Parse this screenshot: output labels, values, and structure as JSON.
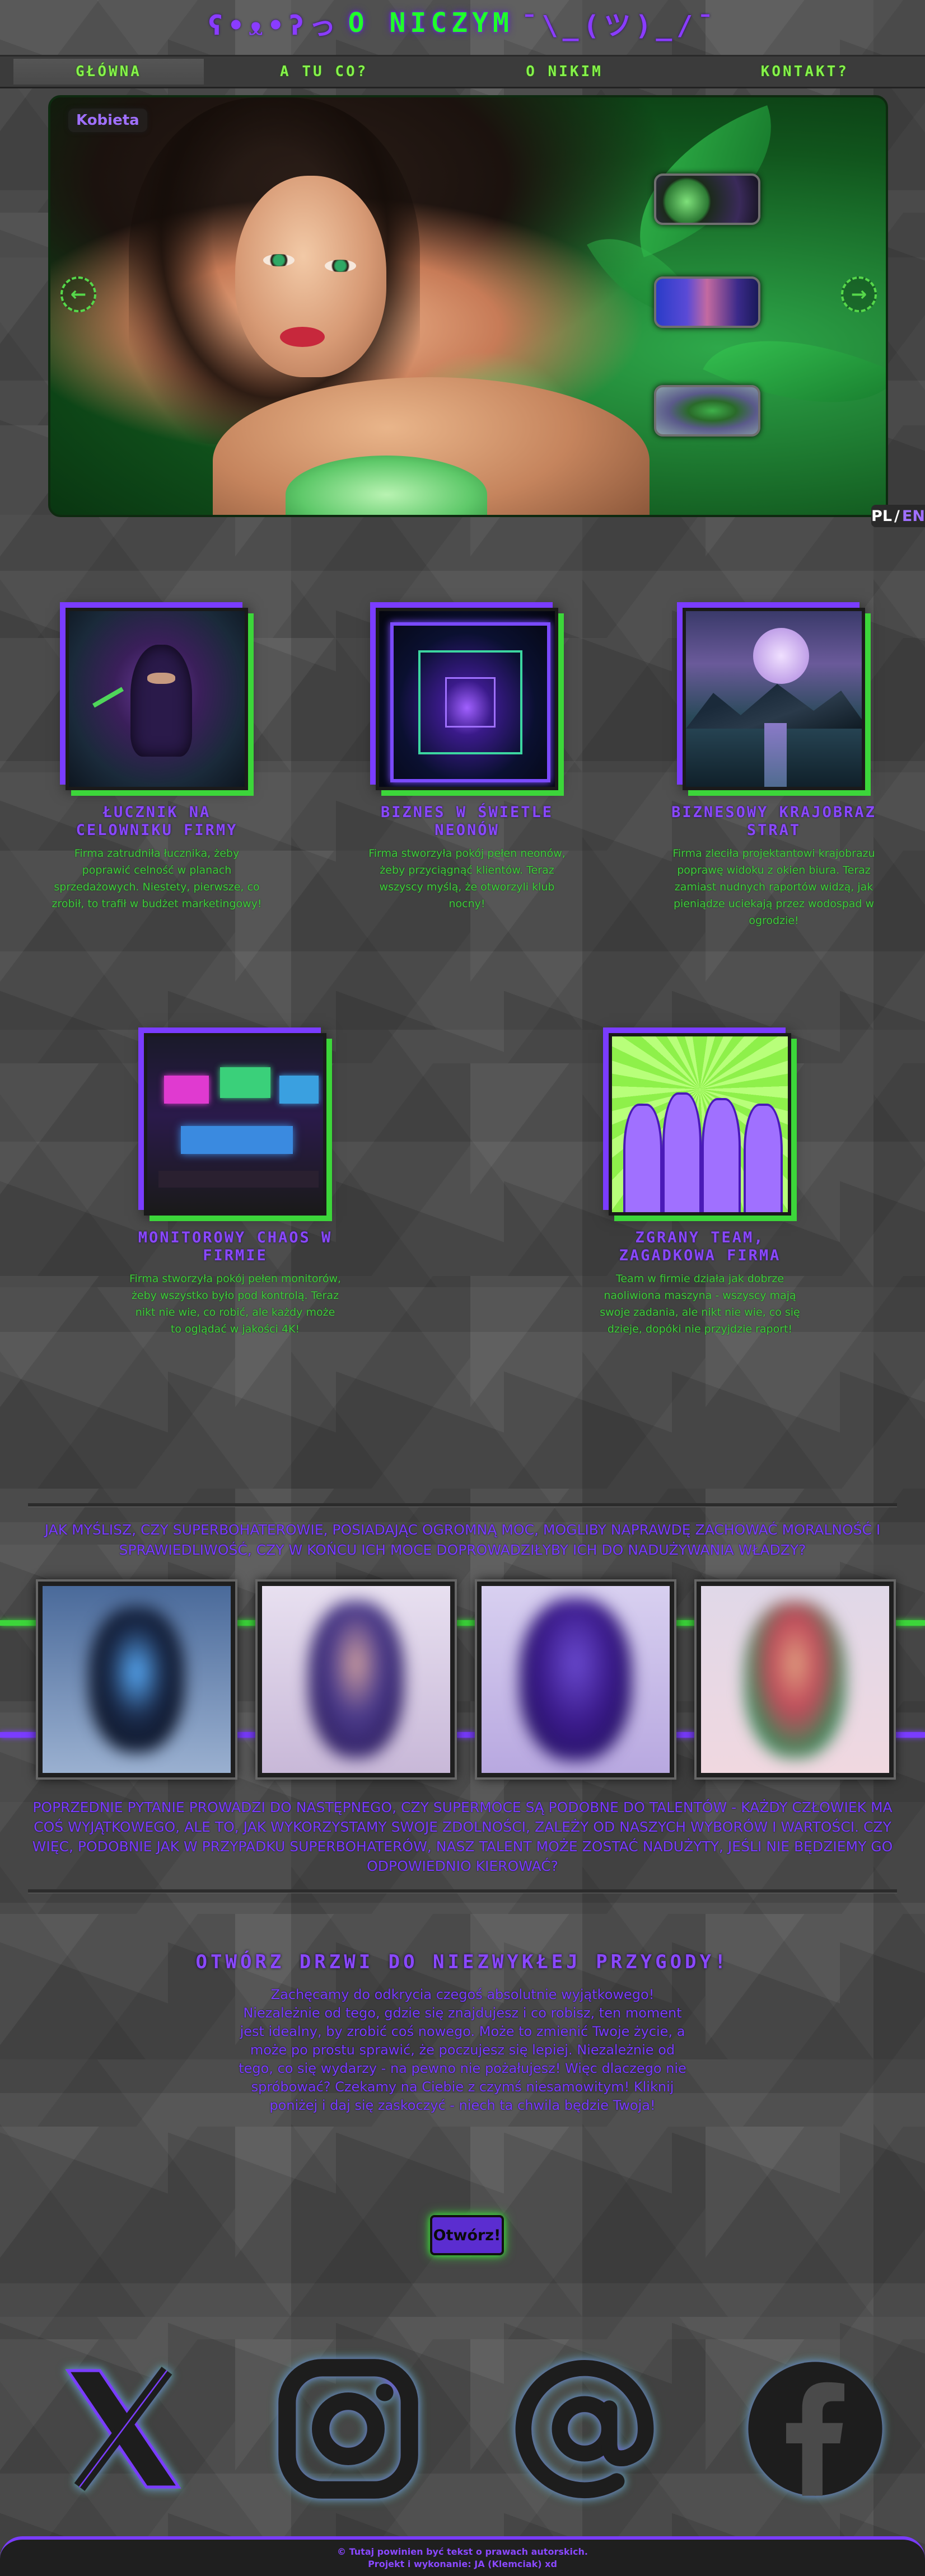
{
  "header": {
    "title_left": "ʕ•ᴥ•ʔっ",
    "title_main": "O NICZYM",
    "title_right": "¯\\_(ツ)_/¯"
  },
  "nav": {
    "items": [
      {
        "label": "GŁÓWNA",
        "active": true
      },
      {
        "label": "A TU CO?"
      },
      {
        "label": "O NIKIM"
      },
      {
        "label": "KONTAKT?"
      }
    ]
  },
  "hero": {
    "badge": "Kobieta",
    "prev_icon": "arrow-left-icon",
    "next_icon": "arrow-right-icon",
    "thumbnails": [
      "planet",
      "cyber-man",
      "fly"
    ]
  },
  "language": {
    "pl": "PL",
    "sep": "/",
    "en": "EN"
  },
  "cards": [
    {
      "title": "ŁUCZNIK NA CELOWNIKU FIRMY",
      "text": "Firma zatrudniła łucznika, żeby poprawić celność w planach sprzedażowych. Niestety, pierwsze, co zrobił, to trafił w budżet marketingowy!"
    },
    {
      "title": "BIZNES W ŚWIETLE NEONÓW",
      "text": "Firma stworzyła pokój pełen neonów, żeby przyciągnąć klientów. Teraz wszyscy myślą, że otworzyli klub nocny!"
    },
    {
      "title": "BIZNESOWY KRAJOBRAZ STRAT",
      "text": "Firma zleciła projektantowi krajobrazu poprawę widoku z okien biura. Teraz zamiast nudnych raportów widzą, jak pieniądze uciekają przez wodospad w ogrodzie!"
    },
    {
      "title": "MONITOROWY CHAOS W FIRMIE",
      "text": "Firma stworzyła pokój pełen monitorów, żeby wszystko było pod kontrolą. Teraz nikt nie wie, co robić, ale każdy może to oglądać w jakości 4K!"
    },
    {
      "title": "ZGRANY TEAM, ZAGADKOWA FIRMA",
      "text": "Team w firmie działa jak dobrze naoliwiona maszyna - wszyscy mają swoje zadania, ale nikt nie wie, co się dzieje, dopóki nie przyjdzie raport!"
    }
  ],
  "heroes_section": {
    "question": "JAK MYŚLISZ, CZY SUPERBOHATEROWIE, POSIADAJĄC OGROMNĄ MOC, MOGLIBY NAPRAWDĘ ZACHOWAĆ MORALNOŚĆ I SPRAWIEDLIWOŚĆ, CZY W KOŃCU ICH MOCE DOPROWADZIŁYBY ICH DO NADUŻYWANIA WŁADZY?",
    "answer": "POPRZEDNIE PYTANIE PROWADZI DO NASTĘPNEGO, CZY SUPERMOCE SĄ PODOBNE DO TALENTÓW - KAŻDY CZŁOWIEK MA COŚ WYJĄTKOWEGO, ALE TO, JAK WYKORZYSTAMY SWOJE ZDOLNOŚCI, ZALEŻY OD NASZYCH WYBORÓW I WARTOŚCI. CZY WIĘC, PODOBNIE JAK W PRZYPADKU SUPERBOHATERÓW, NASZ TALENT MOŻE ZOSTAĆ NADUŻYTY, JEŚLI NIE BĘDZIEMY GO ODPOWIEDNIO KIEROWAĆ?",
    "colors": {
      "green": "#3cd63a",
      "purple": "#7a3cff"
    }
  },
  "cta": {
    "heading": "OTWÓRZ DRZWI DO NIEZWYKŁEJ PRZYGODY!",
    "text": "Zachęcamy do odkrycia czegoś absolutnie wyjątkowego! Niezależnie od tego, gdzie się znajdujesz i co robisz, ten moment jest idealny, by zrobić coś nowego. Może to zmienić Twoje życie, a może po prostu sprawić, że poczujesz się lepiej. Niezależnie od tego, co się wydarzy - na pewno nie pożałujesz! Więc dlaczego nie spróbować? Czekamy na Ciebie z czymś niesamowitym! Kliknij poniżej i daj się zaskoczyć - niech ta chwila będzie Twoja!",
    "button": "Otwórz!"
  },
  "social": {
    "icons": [
      "x-icon",
      "instagram-icon",
      "at-icon",
      "facebook-icon"
    ]
  },
  "footer": {
    "line1": "© Tutaj powinien być tekst o prawach autorskich.",
    "line2": "Projekt i wykonanie: JA (Klemciak) xd"
  }
}
